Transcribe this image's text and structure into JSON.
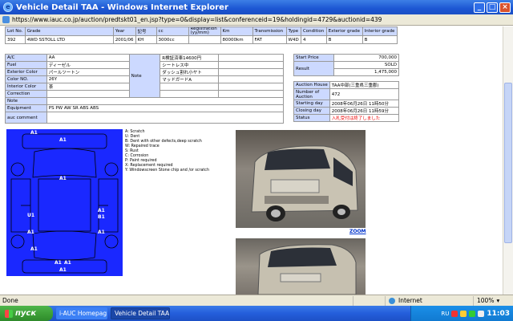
{
  "window": {
    "title": "Vehicle Detail TAA - Windows Internet Explorer",
    "minimize": "_",
    "maximize": "□",
    "close": "×"
  },
  "address": {
    "url": "https://www.iauc.co.jp/auction/predtskt01_en.jsp?type=0&display=list&conferenceid=19&holdingid=4729&auctionid=439"
  },
  "lot_table": {
    "headers": [
      "Lot No.",
      "Grade",
      "Year",
      "記号",
      "cc",
      "Registration (yy/mm)",
      "Km",
      "Transmission",
      "Type",
      "Condition",
      "Exterior grade",
      "Interior grade"
    ],
    "values": [
      "392",
      "4WD SSTOLL LTD",
      "2001/06",
      "KH",
      "3000cc",
      "",
      "80000km",
      "FAT",
      "W4D",
      "4",
      "B",
      "B"
    ]
  },
  "specs": {
    "rows": [
      {
        "label": "A/C",
        "value": "AA"
      },
      {
        "label": "Fuel",
        "value": "ディーゼル"
      },
      {
        "label": "Exterior Color",
        "value": "パールツートン"
      },
      {
        "label": "Color NO.",
        "value": "26Y"
      },
      {
        "label": "Interior Color",
        "value": "茶"
      },
      {
        "label": "Correction",
        "value": ""
      },
      {
        "label": "Note",
        "value": ""
      },
      {
        "label": "Equipment",
        "value": "PS PW AW SR ABS ABS"
      },
      {
        "label": "auc comment",
        "value": ""
      }
    ],
    "note_label": "Note",
    "note_lines": [
      "R検証済車14600円",
      "シートレス中",
      "ダッシュ割れ小ヤト",
      "マッドガードA"
    ]
  },
  "price": {
    "start_label": "Start Price",
    "start_value": "700,000",
    "result_label": "Result",
    "result_value": "SOLD",
    "result_amount": "1,475,000"
  },
  "auction": {
    "house_label": "Auction House",
    "house_value": "TAA中部(三重県三重郡)",
    "number_label": "Number of Auction",
    "number_value": "472",
    "starting_label": "Starting day",
    "starting_value": "2008年06月26日 11時50分",
    "closing_label": "Closing day",
    "closing_value": "2008年06月26日 11時59分",
    "status_label": "Status",
    "status_value": "入札受付は終了しました",
    "status_color": "#ee0000"
  },
  "diagram": {
    "marks": [
      "A1",
      "A1",
      "A1",
      "U1",
      "A1",
      "B1",
      "A1",
      "A1",
      "A1",
      "A1",
      "A1",
      "A1"
    ],
    "color": "#1a28ff"
  },
  "legend": [
    "A: Scratch",
    "U: Dent",
    "B: Dent with other defects,deep scratch",
    "W: Repaired trace",
    "S: Rust",
    "C: Corrosion",
    "P: Paint required",
    "X: Replacement required",
    "Y: Windowscreen Stone chip and /or scratch"
  ],
  "zoom_label": "ZOOM",
  "status_bar": {
    "left": "Done",
    "zone": "Internet",
    "zoom": "100%"
  },
  "taskbar": {
    "start": "пуск",
    "tasks": [
      "i-AUC Homepag...",
      "Vehicle Detail TAA..."
    ],
    "lang": "RU",
    "clock": "11:03"
  }
}
